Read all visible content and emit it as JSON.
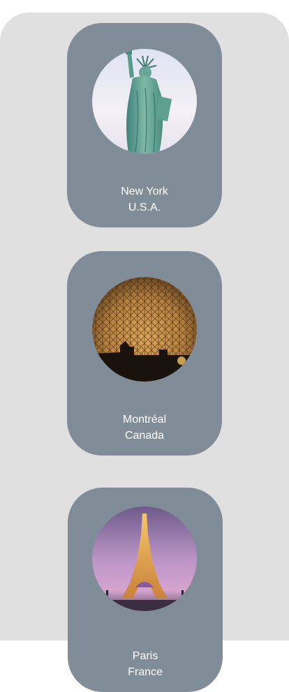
{
  "destinations": [
    {
      "city": "New York",
      "country": "U.S.A.",
      "image": "statue-of-liberty-photo"
    },
    {
      "city": "Montréal",
      "country": "Canada",
      "image": "biosphere-dome-photo"
    },
    {
      "city": "Paris",
      "country": "France",
      "image": "eiffel-tower-photo"
    }
  ],
  "colors": {
    "background": "#e0e0e0",
    "card": "#808c98",
    "text": "#ffffff"
  }
}
